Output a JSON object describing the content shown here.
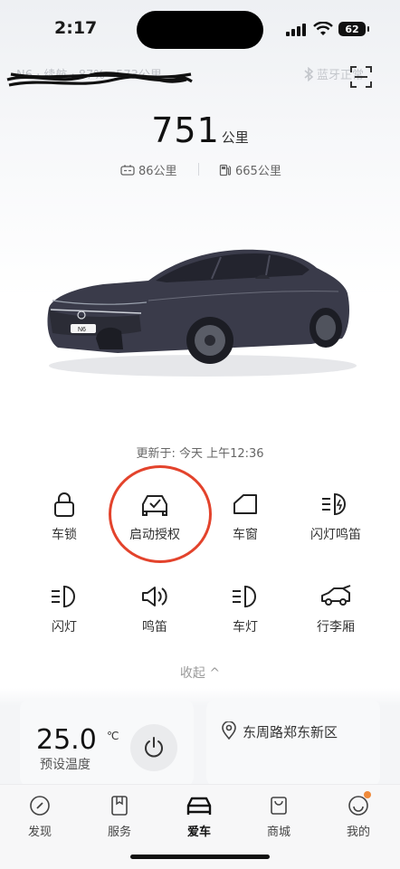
{
  "status_bar": {
    "time": "2:17",
    "battery": "62"
  },
  "header": {
    "vehicle_name": "N6 · 续航 · 87% · 573公里",
    "bt_status": "蓝牙正常"
  },
  "range": {
    "value": "751",
    "unit": "公里",
    "battery_range": "86公里",
    "fuel_range": "665公里"
  },
  "update_time": "更新于: 今天 上午12:36",
  "car": {
    "badge": "N6",
    "body_color": "#3a3b4a"
  },
  "controls": [
    {
      "label": "车锁",
      "icon": "lock-icon"
    },
    {
      "label": "启动授权",
      "icon": "car-check-icon"
    },
    {
      "label": "车窗",
      "icon": "window-icon"
    },
    {
      "label": "闪灯鸣笛",
      "icon": "flash-horn-icon"
    },
    {
      "label": "闪灯",
      "icon": "headlight-icon"
    },
    {
      "label": "鸣笛",
      "icon": "horn-icon"
    },
    {
      "label": "车灯",
      "icon": "car-light-icon"
    },
    {
      "label": "行李厢",
      "icon": "trunk-icon"
    }
  ],
  "collapse_label": "收起 ^",
  "climate": {
    "temperature": "25.0",
    "unit": "℃",
    "label": "预设温度"
  },
  "location": {
    "text": "东周路郑东新区"
  },
  "tabs": [
    {
      "label": "发现",
      "icon": "compass-icon"
    },
    {
      "label": "服务",
      "icon": "bookmark-icon"
    },
    {
      "label": "爱车",
      "icon": "car-icon",
      "active": true
    },
    {
      "label": "商城",
      "icon": "shop-icon"
    },
    {
      "label": "我的",
      "icon": "smile-icon"
    }
  ],
  "colors": {
    "accent_ring": "#e3432c",
    "notification_dot": "#ef8a3a"
  }
}
